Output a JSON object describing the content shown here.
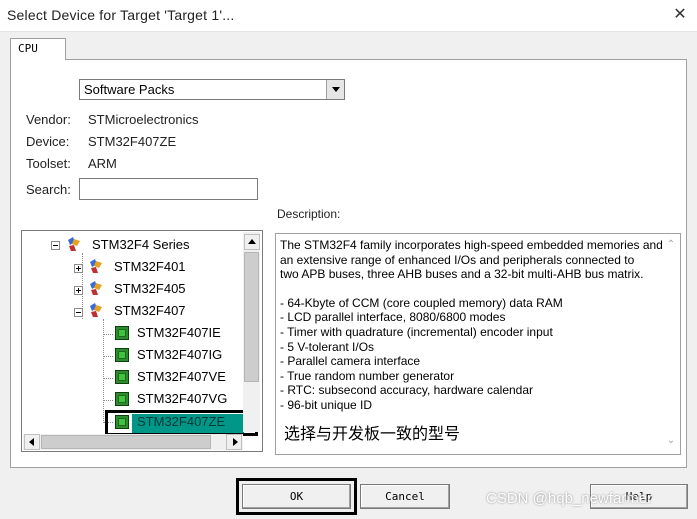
{
  "window": {
    "title": "Select Device for Target 'Target 1'...",
    "close_glyph": "✕"
  },
  "tabs": [
    {
      "label": "CPU",
      "active": true
    }
  ],
  "device_database": {
    "selected": "Software Packs"
  },
  "info": {
    "vendor_label": "Vendor:",
    "vendor_value": "STMicroelectronics",
    "device_label": "Device:",
    "device_value": "STM32F407ZE",
    "toolset_label": "Toolset:",
    "toolset_value": "ARM",
    "search_label": "Search:",
    "search_value": ""
  },
  "description": {
    "label": "Description:",
    "lines": [
      "The STM32F4 family incorporates high-speed embedded memories and",
      "an extensive range of enhanced I/Os and peripherals connected to",
      "two APB buses, three AHB buses and a 32-bit multi-AHB bus matrix.",
      "",
      "- 64-Kbyte of CCM (core coupled memory) data RAM",
      "- LCD parallel interface, 8080/6800 modes",
      "- Timer with quadrature (incremental) encoder input",
      "- 5 V-tolerant I/Os",
      "- Parallel camera interface",
      "- True random number generator",
      "- RTC: subsecond accuracy, hardware calendar",
      "- 96-bit unique ID"
    ],
    "annotation": "选择与开发板一致的型号"
  },
  "tree": {
    "series": "STM32F4 Series",
    "groups": [
      {
        "label": "STM32F401",
        "expanded": false
      },
      {
        "label": "STM32F405",
        "expanded": false
      },
      {
        "label": "STM32F407",
        "expanded": true
      }
    ],
    "devices": [
      {
        "label": "STM32F407IE",
        "selected": false
      },
      {
        "label": "STM32F407IG",
        "selected": false
      },
      {
        "label": "STM32F407VE",
        "selected": false
      },
      {
        "label": "STM32F407VG",
        "selected": false
      },
      {
        "label": "STM32F407ZE",
        "selected": true
      }
    ]
  },
  "buttons": {
    "ok": "OK",
    "cancel": "Cancel",
    "help": "Help"
  },
  "watermark": "CSDN @hqb_newfarmer",
  "colors": {
    "selection": "#009688",
    "chip_icon": "#2d8c2d",
    "highlight_outline": "#000000"
  }
}
